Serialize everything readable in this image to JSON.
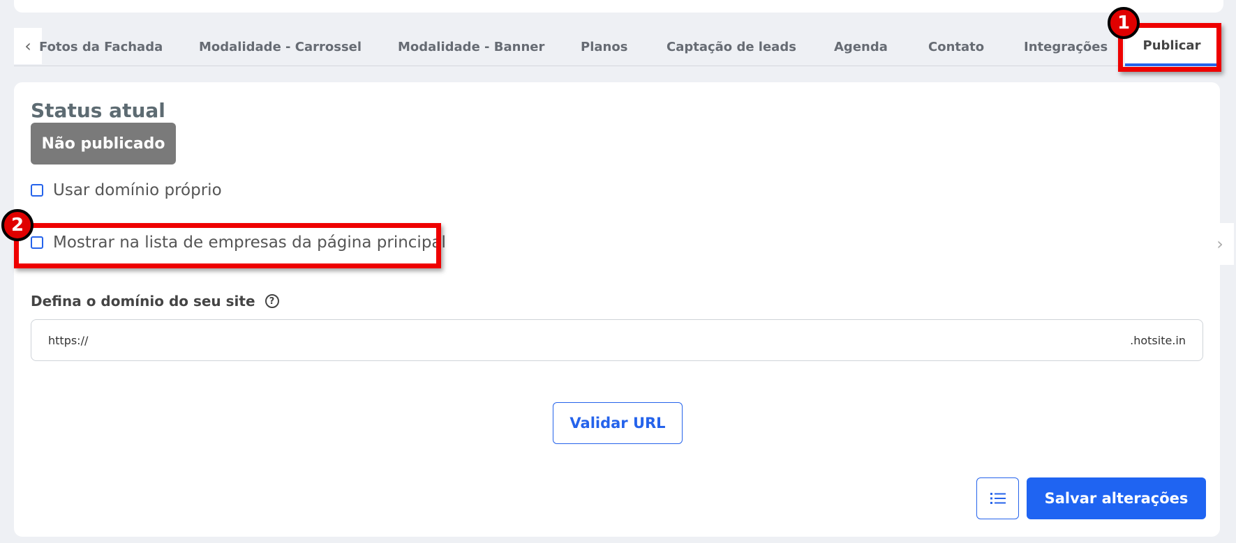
{
  "tabs": [
    {
      "label": "Fotos da Fachada",
      "active": false
    },
    {
      "label": "Modalidade - Carrossel",
      "active": false
    },
    {
      "label": "Modalidade - Banner",
      "active": false
    },
    {
      "label": "Planos",
      "active": false
    },
    {
      "label": "Captação de leads",
      "active": false
    },
    {
      "label": "Agenda",
      "active": false
    },
    {
      "label": "Contato",
      "active": false
    },
    {
      "label": "Integrações",
      "active": false
    },
    {
      "label": "Publicar",
      "active": true
    }
  ],
  "status": {
    "label": "Status atual",
    "badge": "Não publicado"
  },
  "options": {
    "own_domain": "Usar domínio próprio",
    "show_in_list": "Mostrar na lista de empresas da página principal"
  },
  "domain": {
    "label": "Defina o domínio do seu site",
    "prefix": "https://",
    "suffix": ".hotsite.in",
    "value": ""
  },
  "buttons": {
    "validate": "Validar URL",
    "save": "Salvar alterações"
  },
  "callouts": {
    "one": "1",
    "two": "2"
  },
  "colors": {
    "accent": "#1f64f2",
    "callout": "#ee0000",
    "badge_bg": "#7a7a7a"
  }
}
